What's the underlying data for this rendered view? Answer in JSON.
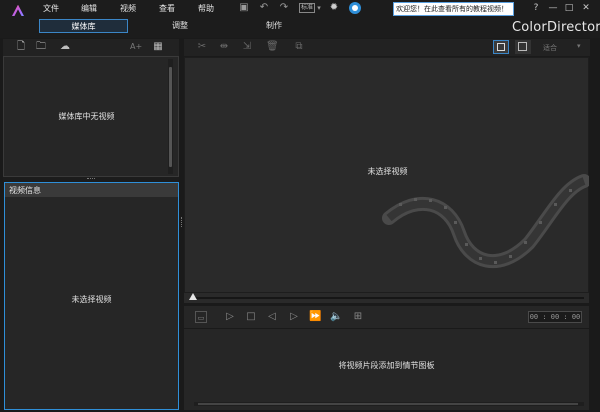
{
  "menu": {
    "items": [
      "文件",
      "编辑",
      "视频",
      "查看",
      "帮助"
    ],
    "resolution_label": "标准"
  },
  "welcome_text": "欢迎您！在此查看所有的教程视频！",
  "window_controls": {
    "help": "?",
    "minimize": "—",
    "maximize": "□",
    "close": "✕"
  },
  "tabs": [
    {
      "label": "媒体库",
      "active": true
    },
    {
      "label": "调整",
      "active": false
    },
    {
      "label": "制作",
      "active": false
    }
  ],
  "brand": "ColorDirector",
  "library": {
    "empty_text": "媒体库中无视频",
    "text_size_label": "A+"
  },
  "video_info": {
    "header": "视频信息",
    "empty_text": "未选择视频"
  },
  "preview": {
    "empty_text": "未选择视频",
    "fit_label": "适合"
  },
  "playback": {
    "timecode": "00 : 00 : 00"
  },
  "storyboard": {
    "hint_text": "将视频片段添加到情节图板"
  },
  "colors": {
    "accent": "#2f8fd8",
    "background": "#1a1a1a",
    "panel": "#262626"
  }
}
